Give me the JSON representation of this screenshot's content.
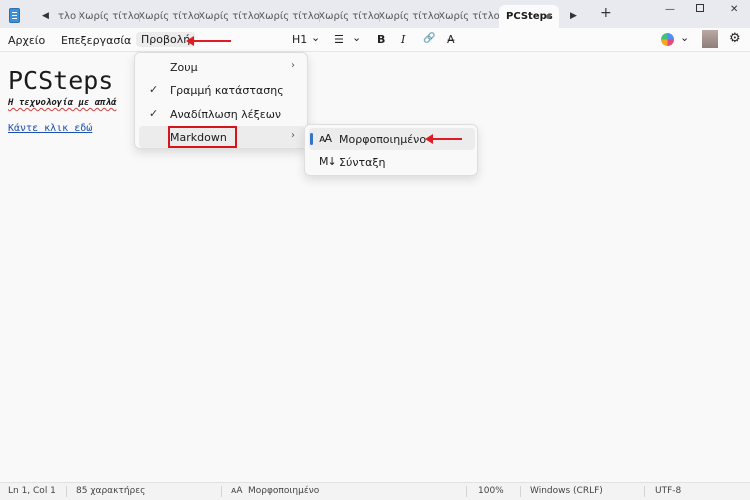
{
  "tabs": {
    "scroll_left": "◀",
    "items": [
      "τλο",
      "Χωρίς τίτλο",
      "Χωρίς τίτλο",
      "Χωρίς τίτλο",
      "Χωρίς τίτλο",
      "Χωρίς τίτλο",
      "Χωρίς τίτλο",
      "Χωρίς τίτλο"
    ],
    "active": "PCSteps",
    "scroll_right": "▶",
    "new_tab": "+"
  },
  "window": {
    "minimize": "—",
    "close": "✕"
  },
  "menubar": {
    "file": "Αρχείο",
    "edit": "Επεξεργασία",
    "view": "Προβολή"
  },
  "toolbar": {
    "heading": "H1",
    "heading_chevron": "⌄",
    "list": "☰",
    "list_chevron": "⌄",
    "bold": "B",
    "italic": "I",
    "link": "🔗",
    "clear_format": "A̶",
    "copilot_chevron": "⌄",
    "settings": "⚙"
  },
  "document": {
    "title": "PCSteps",
    "subtitle": "Η τεχνολογία με απλά",
    "link": "Κάντε κλικ εδώ"
  },
  "view_menu": {
    "items": [
      {
        "label": "Ζουμ",
        "check": "",
        "arrow": "›"
      },
      {
        "label": "Γραμμή κατάστασης",
        "check": "✓",
        "arrow": ""
      },
      {
        "label": "Αναδίπλωση λέξεων",
        "check": "✓",
        "arrow": ""
      },
      {
        "label": "Markdown",
        "check": "",
        "arrow": "›"
      }
    ]
  },
  "markdown_submenu": {
    "items": [
      {
        "icon": "ᴀA",
        "label": "Μορφοποιημένο"
      },
      {
        "icon": "M↓",
        "label": "Σύνταξη"
      }
    ]
  },
  "statusbar": {
    "position": "Ln 1, Col 1",
    "chars": "85 χαρακτήρες",
    "mode_icon": "ᴀA",
    "mode": "Μορφοποιημένο",
    "zoom": "100%",
    "line_ending": "Windows (CRLF)",
    "encoding": "UTF-8"
  },
  "colors": {
    "annotation_red": "#e01b24",
    "accent_blue": "#3573c8"
  }
}
